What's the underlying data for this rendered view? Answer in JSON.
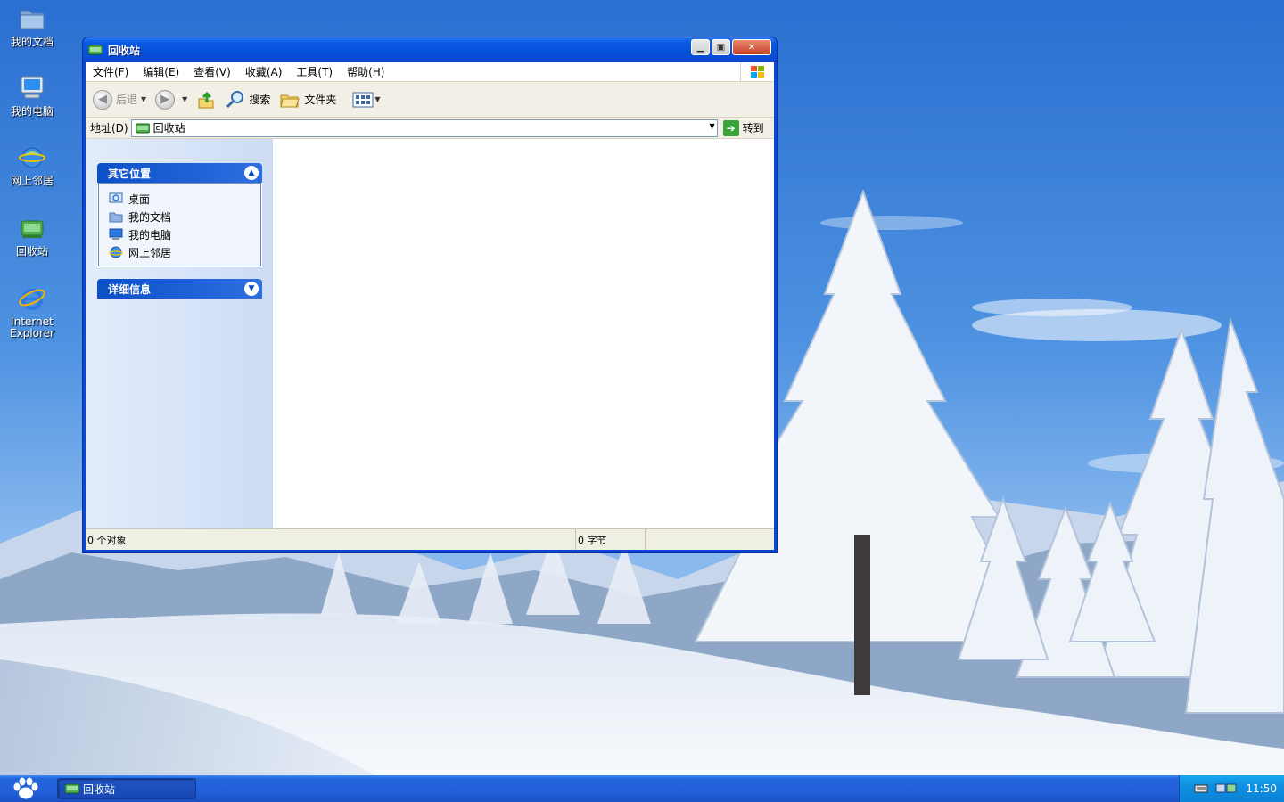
{
  "desktop": {
    "icons": [
      {
        "label": "我的文档",
        "icon": "folder-icon"
      },
      {
        "label": "我的电脑",
        "icon": "computer-icon"
      },
      {
        "label": "网上邻居",
        "icon": "network-icon"
      },
      {
        "label": "回收站",
        "icon": "recycle-bin-icon"
      },
      {
        "label": "Internet Explorer",
        "icon": "ie-icon"
      }
    ]
  },
  "window": {
    "title": "回收站",
    "menu": [
      "文件(F)",
      "编辑(E)",
      "查看(V)",
      "收藏(A)",
      "工具(T)",
      "帮助(H)"
    ],
    "toolbar": {
      "back": "后退",
      "search": "搜索",
      "folders": "文件夹"
    },
    "address": {
      "label": "地址(D)",
      "value": "回收站",
      "go": "转到"
    },
    "taskpane": {
      "other_places": {
        "title": "其它位置",
        "items": [
          "桌面",
          "我的文档",
          "我的电脑",
          "网上邻居"
        ]
      },
      "details": {
        "title": "详细信息"
      }
    },
    "status": {
      "objects": "0 个对象",
      "size": "0 字节"
    }
  },
  "taskbar": {
    "task_label": "回收站",
    "clock": "11:50"
  },
  "colors": {
    "titlebar": "#0551dc",
    "taskbar": "#225fd8",
    "tray": "#0e8fe0",
    "taskpane_header": "#0c50c8"
  }
}
